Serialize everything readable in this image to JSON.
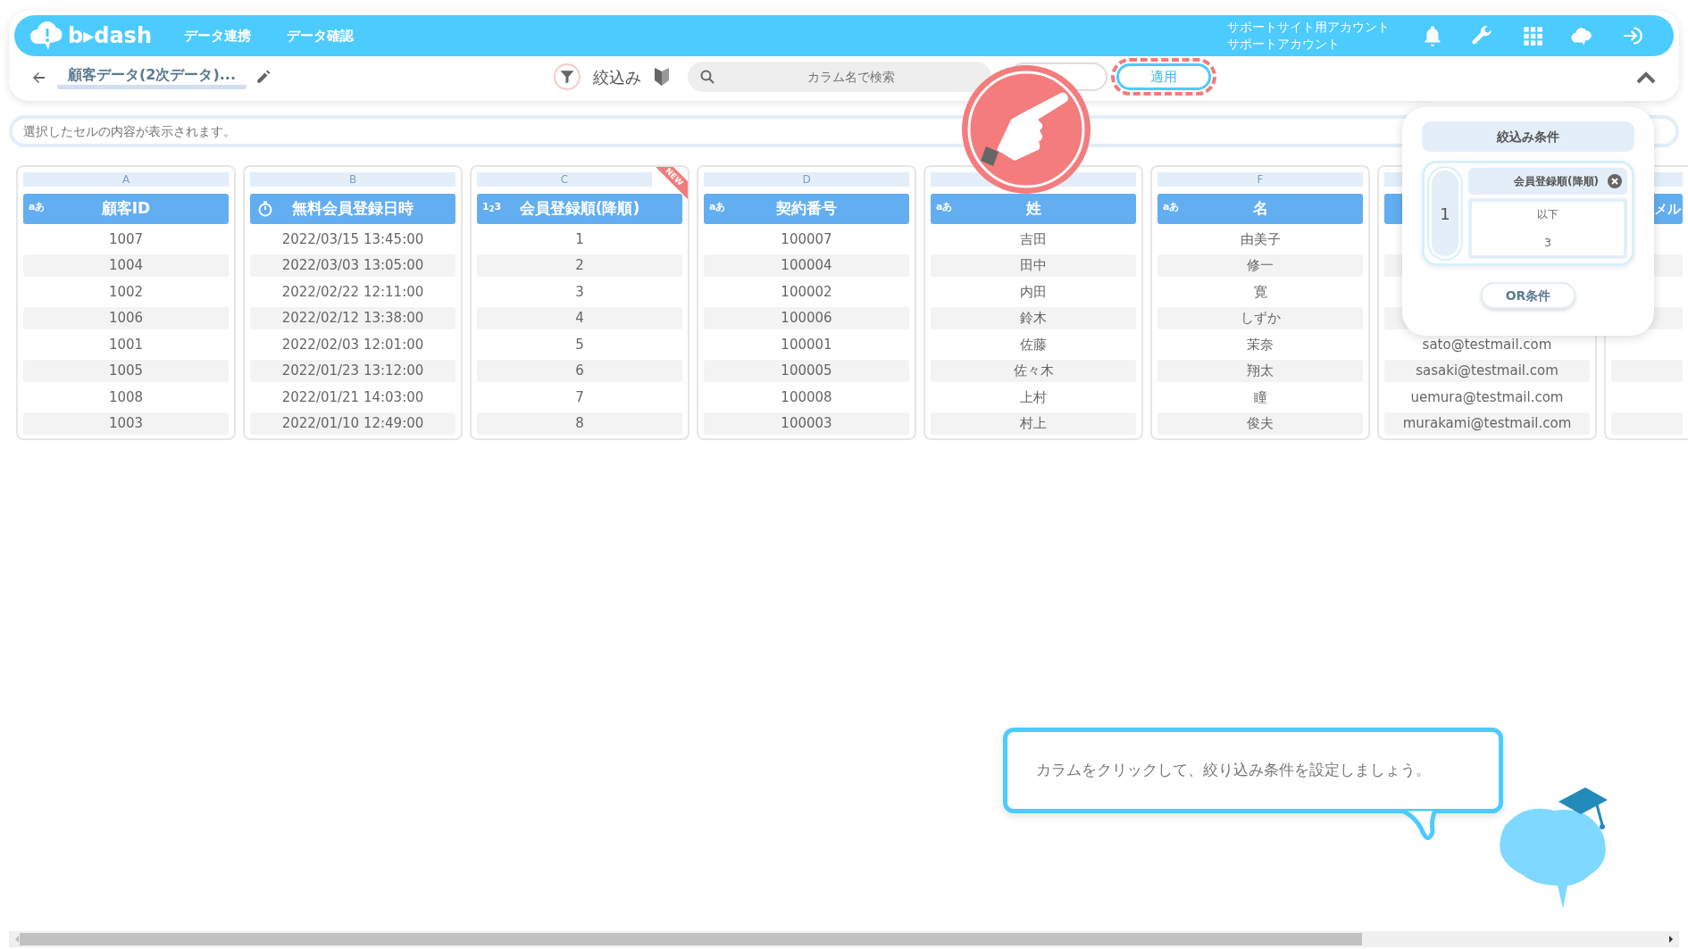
{
  "header": {
    "logo": "b▸dash",
    "nav": [
      {
        "label": "データ連携"
      },
      {
        "label": "データ確認"
      }
    ],
    "account": [
      "サポートサイト用アカウント",
      "サポートアカウント"
    ]
  },
  "toolbar": {
    "title": "顧客データ(2次データ)...",
    "filter_label": "絞込み",
    "search": {
      "placeholder": "カラム名で検索"
    },
    "apply_button": "適用"
  },
  "cell_viewer": {
    "placeholder": "選択したセルの内容が表示されます。"
  },
  "columns": [
    {
      "letter": "A",
      "kind": "text",
      "type_icon": "aあ",
      "title": "顧客ID",
      "cells": [
        "1007",
        "1004",
        "1002",
        "1006",
        "1001",
        "1005",
        "1008",
        "1003"
      ]
    },
    {
      "letter": "B",
      "kind": "datetime",
      "title": "無料会員登録日時",
      "cells": [
        "2022/03/15 13:45:00",
        "2022/03/03 13:05:00",
        "2022/02/22 12:11:00",
        "2022/02/12 13:38:00",
        "2022/02/03 12:01:00",
        "2022/01/23 13:12:00",
        "2022/01/21 14:03:00",
        "2022/01/10 12:49:00"
      ]
    },
    {
      "letter": "C",
      "kind": "number",
      "type_icon": "1$_{2}$3",
      "title": "会員登録順(降順)",
      "ribbon": "NEW",
      "cells": [
        "1",
        "2",
        "3",
        "4",
        "5",
        "6",
        "7",
        "8"
      ]
    },
    {
      "letter": "D",
      "kind": "text",
      "type_icon": "aあ",
      "title": "契約番号",
      "cells": [
        "100007",
        "100004",
        "100002",
        "100006",
        "100001",
        "100005",
        "100008",
        "100003"
      ]
    },
    {
      "kind": "text",
      "type_icon": "aあ",
      "title": "姓",
      "cells": [
        "吉田",
        "田中",
        "内田",
        "鈴木",
        "佐藤",
        "佐々木",
        "上村",
        "村上"
      ]
    },
    {
      "letter": "F",
      "kind": "text",
      "type_icon": "aあ",
      "title": "名",
      "cells": [
        "由美子",
        "修一",
        "寛",
        "しずか",
        "茉奈",
        "翔太",
        "瞳",
        "俊夫"
      ]
    },
    {
      "cells": [
        null,
        null,
        null,
        null,
        "sato@testmail.com",
        "sasaki@testmail.com",
        "uemura@testmail.com",
        "murakami@testmail.com"
      ]
    },
    {
      "title": "メル",
      "cells": [
        null,
        null,
        null,
        null,
        null,
        null,
        null,
        null
      ]
    }
  ],
  "filter_panel": {
    "title": "絞込み条件",
    "groups": [
      {
        "number": "1",
        "conditions": [
          {
            "column": "会員登録順(降順)",
            "operator": "以下",
            "value": "3"
          }
        ]
      }
    ],
    "or_button": "OR条件"
  },
  "hint": "カラムをクリックして、絞り込み条件を設定しましょう。"
}
